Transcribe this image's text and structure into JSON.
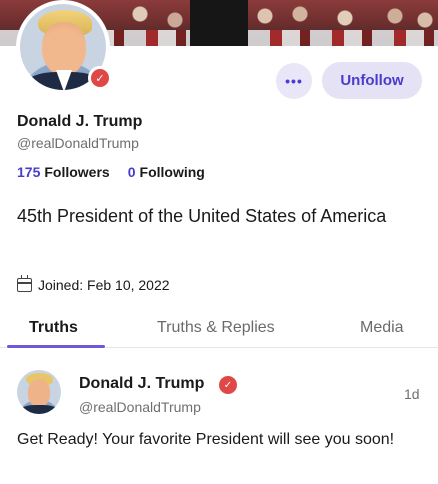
{
  "profile": {
    "name": "Donald J. Trump",
    "handle": "@realDonaldTrump",
    "followers_count": "175",
    "followers_label": "Followers",
    "following_count": "0",
    "following_label": "Following",
    "bio": "45th President of the United States of America",
    "joined": "Joined: Feb 10, 2022",
    "verified_icon": "verified-badge-icon"
  },
  "actions": {
    "more_label": "•••",
    "unfollow_label": "Unfollow"
  },
  "tabs": [
    {
      "label": "Truths",
      "active": true
    },
    {
      "label": "Truths & Replies",
      "active": false
    },
    {
      "label": "Media",
      "active": false
    }
  ],
  "post": {
    "author_name": "Donald J. Trump",
    "author_handle": "@realDonaldTrump",
    "time": "1d",
    "text": "Get Ready! Your favorite President will see you soon!"
  },
  "colors": {
    "accent": "#4a3ccb",
    "accent_bg": "#e6e2f6",
    "verified": "#e04848"
  }
}
